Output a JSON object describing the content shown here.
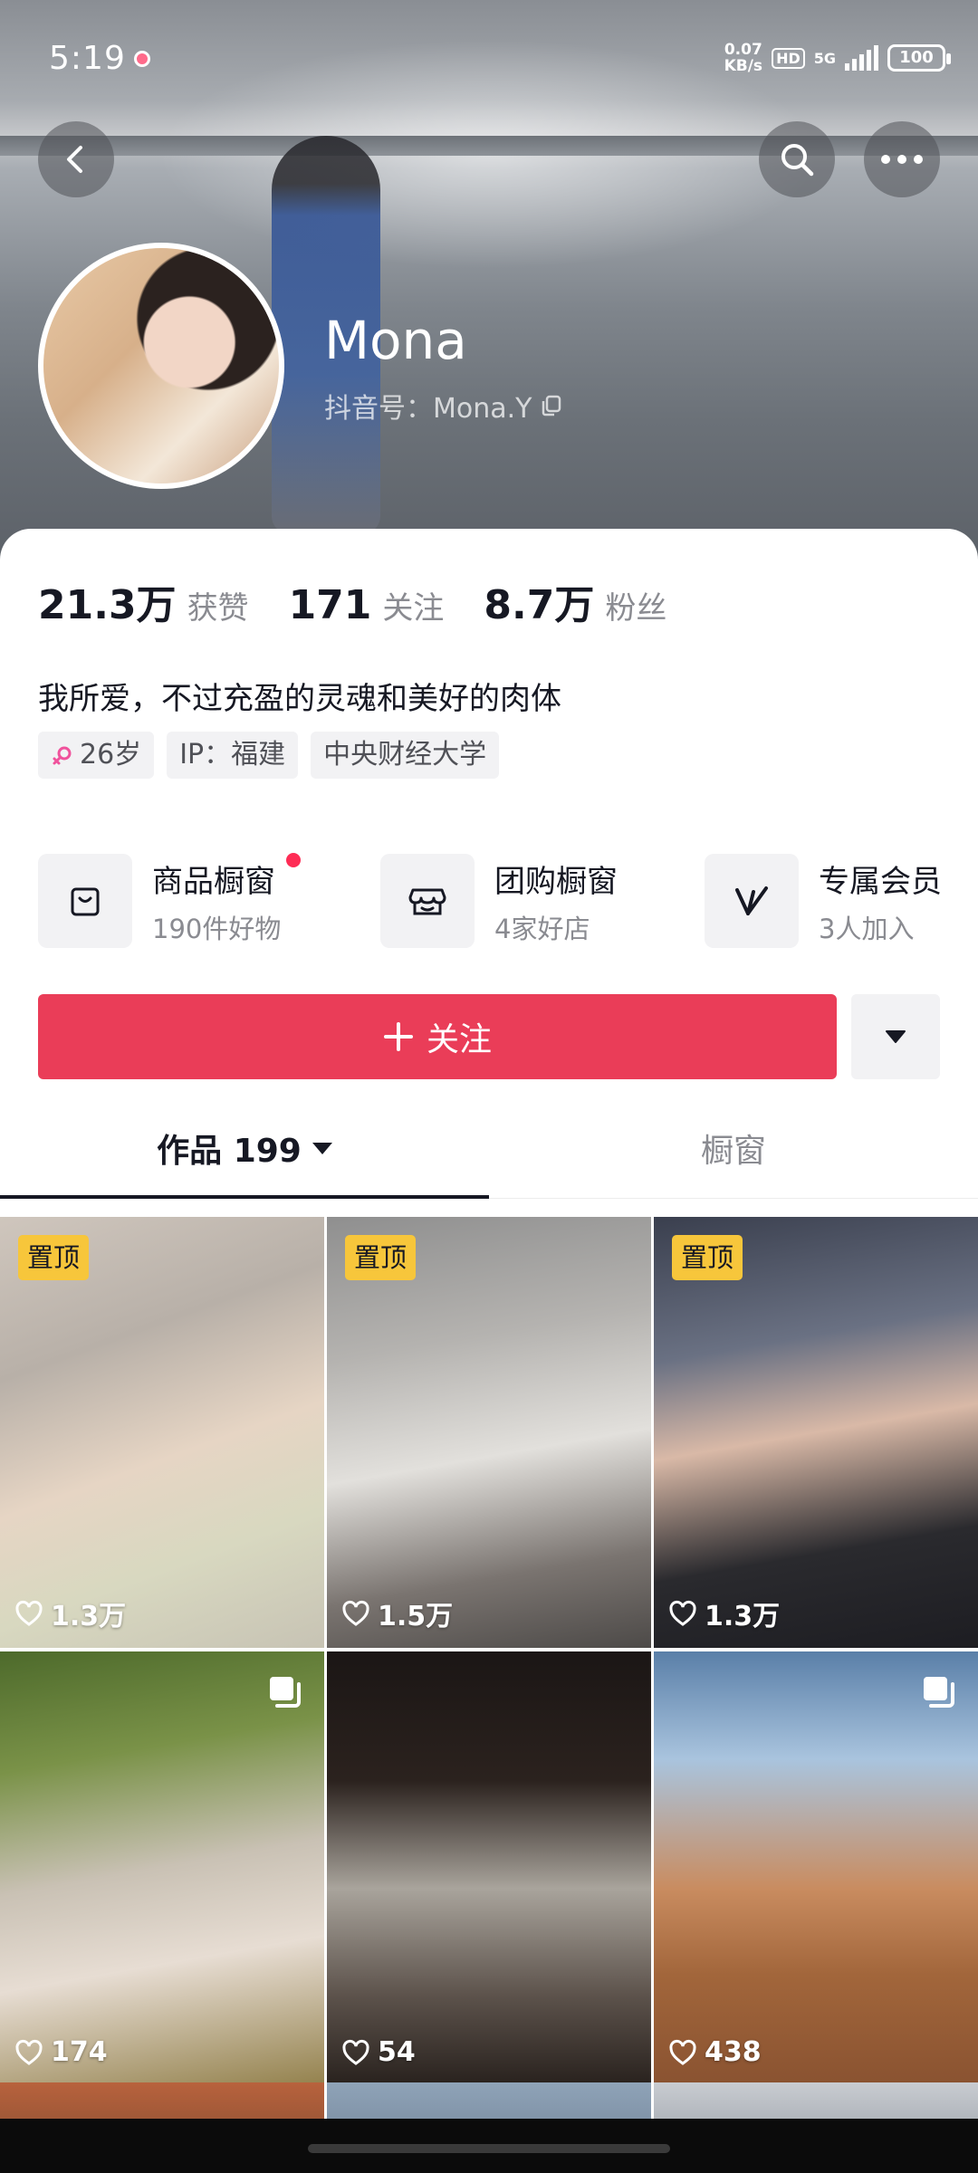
{
  "status_bar": {
    "time": "5:19",
    "net_speed_value": "0.07",
    "net_speed_unit": "KB/s",
    "hd": "HD",
    "network": "5G",
    "battery": "100"
  },
  "profile": {
    "nickname": "Mona",
    "douyin_id": "抖音号：Mona.Y"
  },
  "stats": [
    {
      "value": "21.3万",
      "label": "获赞"
    },
    {
      "value": "171",
      "label": "关注"
    },
    {
      "value": "8.7万",
      "label": "粉丝"
    }
  ],
  "bio": "我所爱，不过充盈的灵魂和美好的肉体",
  "tags": {
    "age": "26岁",
    "ip": "IP：福建",
    "school": "中央财经大学"
  },
  "features": [
    {
      "title": "商品橱窗",
      "subtitle": "190件好物",
      "icon": "bag-icon"
    },
    {
      "title": "团购橱窗",
      "subtitle": "4家好店",
      "icon": "store-icon"
    },
    {
      "title": "专属会员",
      "subtitle": "3人加入",
      "icon": "v-icon"
    }
  ],
  "follow_button": {
    "label": "关注"
  },
  "tabs": {
    "works": "作品 199",
    "showcase": "橱窗"
  },
  "posts": [
    {
      "pinned": "置顶",
      "likes": "1.3万"
    },
    {
      "pinned": "置顶",
      "likes": "1.5万"
    },
    {
      "pinned": "置顶",
      "likes": "1.3万"
    },
    {
      "likes": "174",
      "multi": true
    },
    {
      "likes": "54"
    },
    {
      "likes": "438",
      "multi": true
    }
  ],
  "colors": {
    "follow": "#ea3d58",
    "pin_badge": "#f7c63b",
    "notification_dot": "#fe2c55"
  }
}
